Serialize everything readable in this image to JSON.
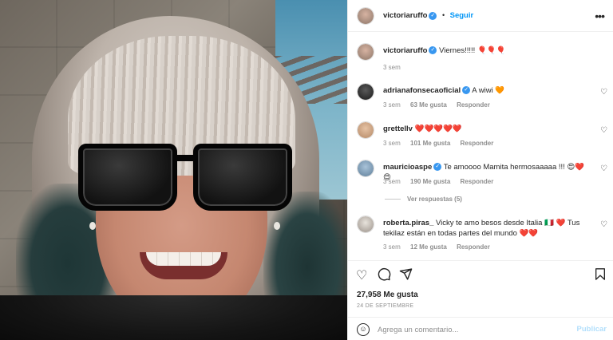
{
  "post": {
    "author": "victoriaruffo",
    "follow_label": "Seguir",
    "more_icon": "more-horizontal-icon",
    "caption": "Viernes!!!!! 🎈🎈🎈",
    "caption_age": "3 sem"
  },
  "comments": [
    {
      "user": "adrianafonsecaoficial",
      "verified": true,
      "text": "A wiwi 🧡",
      "age": "3 sem",
      "likes": "63 Me gusta",
      "reply": "Responder"
    },
    {
      "user": "grettellv",
      "verified": false,
      "text": "❤️❤️❤️❤️❤️",
      "age": "3 sem",
      "likes": "101 Me gusta",
      "reply": "Responder"
    },
    {
      "user": "mauricioaspe",
      "verified": true,
      "text": "Te amoooo Mamita hermosaaaaa !!! 😍❤️😍",
      "age": "3 sem",
      "likes": "190 Me gusta",
      "reply": "Responder",
      "view_replies": "Ver respuestas (5)"
    },
    {
      "user": "roberta.piras_",
      "verified": false,
      "text": "Vicky te amo besos desde Italia 🇮🇹 ❤️ Tus tekilaz están en todas partes del mundo ❤️❤️",
      "age": "3 sem",
      "likes": "12 Me gusta",
      "reply": "Responder"
    }
  ],
  "actions": {
    "like_icon": "heart-outline-icon",
    "comment_icon": "comment-icon",
    "share_icon": "paper-plane-icon",
    "save_icon": "bookmark-icon",
    "likes_count": "27,958 Me gusta",
    "date": "24 DE SEPTIEMBRE"
  },
  "composer": {
    "emoji_icon": "smiley-icon",
    "placeholder": "Agrega un comentario...",
    "publish_label": "Publicar"
  },
  "colors": {
    "accent": "#0095f6",
    "verified": "#3897f0",
    "publish_disabled": "#b2dffc",
    "muted_text": "#8e8e8e"
  }
}
